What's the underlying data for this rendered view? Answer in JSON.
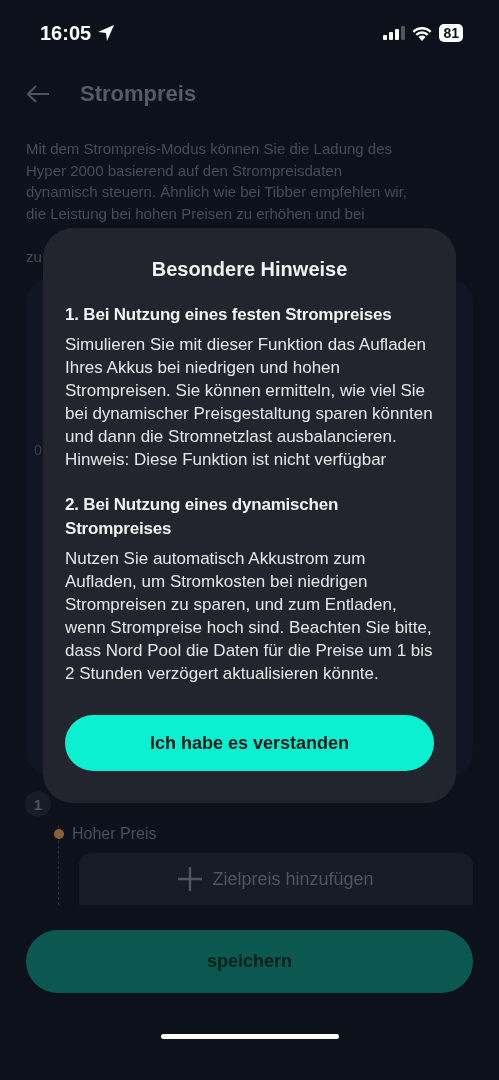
{
  "status_bar": {
    "time": "16:05",
    "battery": "81"
  },
  "header": {
    "title": "Strompreis"
  },
  "intro_lines": [
    " Mit dem Strompreis-Modus können Sie die Ladung des",
    "Hyper 2000 basierend auf den Strompreisdaten",
    "dynamisch steuern. Ähnlich wie bei Tibber empfehlen wir,",
    "die Leistung bei hohen Preisen zu erhöhen und bei",
    "zu"
  ],
  "chart_tick_labels": [
    "0"
  ],
  "step": {
    "number": "1"
  },
  "timeline": {
    "label": "Hoher Preis"
  },
  "add_target_button": {
    "label": "Zielpreis hinzufügen"
  },
  "save_button": {
    "label": "speichern"
  },
  "dialog": {
    "title": "Besondere Hinweise",
    "sections": [
      {
        "heading": "1. Bei Nutzung eines festen Strompreises",
        "body": "Simulieren Sie mit dieser Funktion das Aufladen Ihres Akkus bei niedrigen und hohen Strompreisen. Sie können ermitteln, wie viel Sie bei dynamischer Preisgestaltung sparen könnten und dann die Stromnetzlast ausbalancieren. Hinweis: Diese Funktion ist nicht verfügbar"
      },
      {
        "heading": "2. Bei Nutzung eines dynamischen Strompreises",
        "body": "Nutzen Sie automatisch Akkustrom zum Aufladen, um Stromkosten bei niedrigen Strompreisen zu sparen, und zum Entladen, wenn Strompreise hoch sind. Beachten Sie bitte, dass Nord Pool die Daten für die Preise um 1 bis 2 Stunden verzögert aktualisieren könnte."
      }
    ],
    "confirm_button": "Ich habe es verstanden"
  }
}
